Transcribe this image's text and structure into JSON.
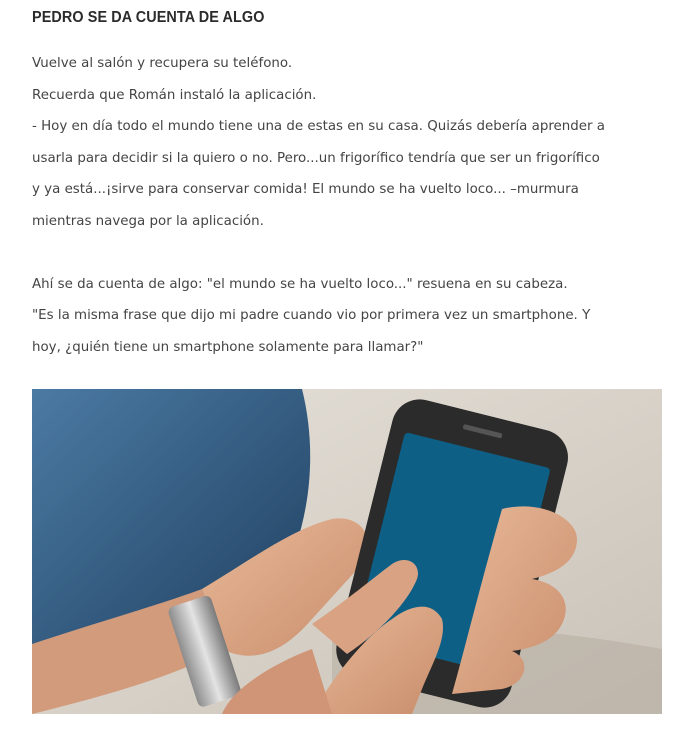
{
  "article": {
    "heading": "PEDRO SE DA CUENTA DE ALGO",
    "paragraph_1": [
      "Vuelve al salón y recupera su teléfono.",
      "Recuerda que Román instaló la aplicación.",
      "- Hoy en día todo el mundo tiene una de estas en su casa. Quizás debería aprender a",
      "usarla para decidir si la quiero o no. Pero...un frigorífico tendría que ser un frigorífico",
      "y ya está...¡sirve para conservar comida! El mundo se ha vuelto loco... –murmura",
      "mientras navega por la aplicación."
    ],
    "paragraph_2": [
      "Ahí se da cuenta de algo: \"el mundo se ha vuelto loco...\" resuena en su cabeza.",
      "\"Es la misma frase que dijo mi padre cuando vio por primera vez un smartphone. Y",
      "hoy, ¿quién tiene un smartphone solamente para llamar?\""
    ]
  },
  "photo": {
    "screen_color": "#0e5f86",
    "sofa_color": "#2f5d86"
  }
}
